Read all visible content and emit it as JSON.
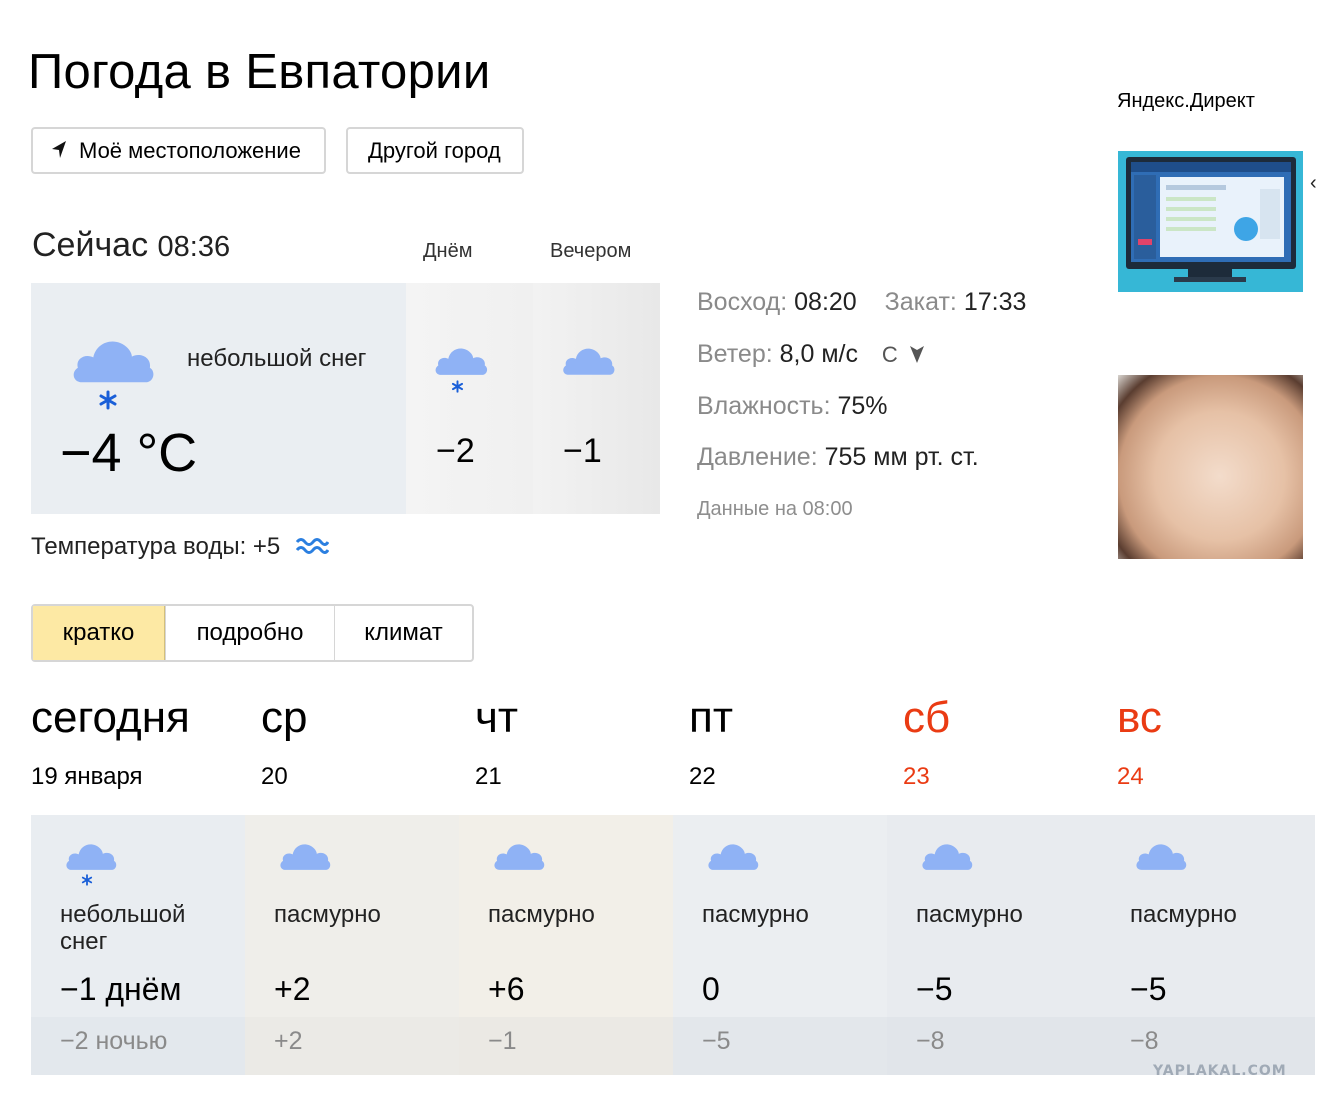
{
  "header": {
    "title": "Погода в Евпатории"
  },
  "buttons": {
    "my_location": "Моё местоположение",
    "other_city": "Другой город"
  },
  "now": {
    "label": "Сейчас",
    "time": "08:36",
    "condition": "небольшой снег",
    "temperature": "−4 °C",
    "icon": "cloud-snow-icon",
    "day_label": "Днём",
    "day_temp": "−2",
    "day_icon": "cloud-snow-icon",
    "evening_label": "Вечером",
    "evening_temp": "−1",
    "evening_icon": "cloud-icon"
  },
  "water": {
    "label": "Температура воды: +5",
    "icon": "water-waves-icon"
  },
  "details": {
    "sunrise_label": "Восход:",
    "sunrise": "08:20",
    "sunset_label": "Закат:",
    "sunset": "17:33",
    "wind_label": "Ветер:",
    "wind": "8,0 м/с",
    "wind_dir": "С",
    "humidity_label": "Влажность:",
    "humidity": "75%",
    "pressure_label": "Давление:",
    "pressure": "755 мм рт. ст.",
    "data_time": "Данные на 08:00"
  },
  "ads": {
    "label": "Яндекс.Директ"
  },
  "tabs": [
    "кратко",
    "подробно",
    "климат"
  ],
  "forecast": [
    {
      "day": "сегодня",
      "date": "19 января",
      "condition": "небольшой снег",
      "day_temp": "−1 днём",
      "night_temp": "−2 ночью",
      "icon": "cloud-snow-icon",
      "weekend": false
    },
    {
      "day": "ср",
      "date": "20",
      "condition": "пасмурно",
      "day_temp": "+2",
      "night_temp": "+2",
      "icon": "cloud-icon",
      "weekend": false
    },
    {
      "day": "чт",
      "date": "21",
      "condition": "пасмурно",
      "day_temp": "+6",
      "night_temp": "−1",
      "icon": "cloud-icon",
      "weekend": false
    },
    {
      "day": "пт",
      "date": "22",
      "condition": "пасмурно",
      "day_temp": "0",
      "night_temp": "−5",
      "icon": "cloud-icon",
      "weekend": false
    },
    {
      "day": "сб",
      "date": "23",
      "condition": "пасмурно",
      "day_temp": "−5",
      "night_temp": "−8",
      "icon": "cloud-icon",
      "weekend": true
    },
    {
      "day": "вс",
      "date": "24",
      "condition": "пасмурно",
      "day_temp": "−5",
      "night_temp": "−8",
      "icon": "cloud-icon",
      "weekend": true
    }
  ],
  "colors": {
    "weekend": "#ea3b13",
    "active_tab": "#fde9a4",
    "cloud": "#8fb2f5",
    "snowflake": "#1a5fd8"
  },
  "watermark": "YAPLAKAL.COM"
}
